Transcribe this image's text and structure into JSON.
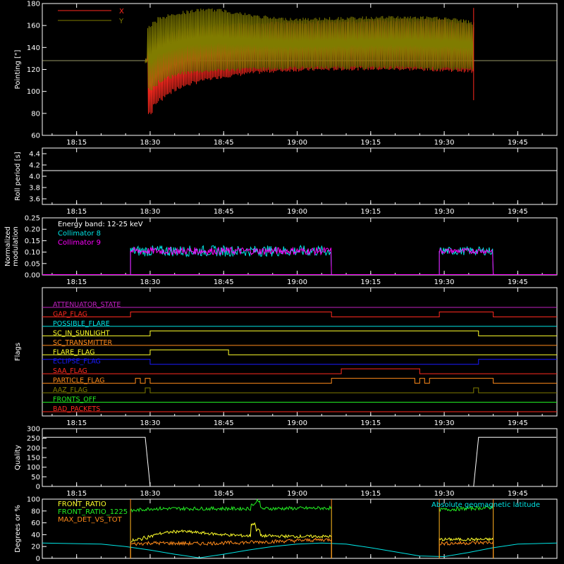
{
  "colors": {
    "background": "#000000",
    "axes": "#ffffff",
    "red": "#ff2a1f",
    "olive": "#807c00",
    "cyan": "#00e5e5",
    "magenta": "#ff00ff",
    "white": "#ffffff",
    "yellow": "#ffff2a",
    "orange": "#ff8a1a",
    "green": "#22ee22",
    "blue": "#1a1aff",
    "purple": "#c020c0"
  },
  "x_ticks": [
    "18:15",
    "18:30",
    "18:45",
    "19:00",
    "19:15",
    "19:30",
    "19:45"
  ],
  "chart_data": [
    {
      "type": "line",
      "name": "pointing",
      "ylabel": "Pointing [\"]",
      "ylim": [
        60,
        180
      ],
      "yticks": [
        "60",
        "80",
        "100",
        "120",
        "140",
        "160",
        "180"
      ],
      "legend": [
        {
          "label": "X",
          "color": "#ff2a1f"
        },
        {
          "label": "Y",
          "color": "#807c00"
        }
      ],
      "legend_position": "top-left",
      "reference_y": 128,
      "series": [
        {
          "name": "X",
          "color": "#ff2a1f",
          "x": [
            "18:29",
            "18:30",
            "18:31",
            "18:33",
            "18:36",
            "18:40",
            "18:45",
            "18:50",
            "18:55",
            "19:00",
            "19:10",
            "19:20",
            "19:30",
            "19:35",
            "19:36"
          ],
          "upper": [
            128,
            140,
            146,
            152,
            157,
            160,
            162,
            163,
            164,
            164,
            165,
            166,
            166,
            163,
            161
          ],
          "lower": [
            128,
            78,
            88,
            94,
            102,
            108,
            112,
            115,
            117,
            118,
            119,
            119,
            118,
            117,
            116
          ]
        },
        {
          "name": "Y",
          "color": "#807c00",
          "x": [
            "18:29",
            "18:30",
            "18:32",
            "18:35",
            "18:38",
            "18:41",
            "18:45",
            "18:50",
            "18:55",
            "19:00",
            "19:10",
            "19:20",
            "19:30",
            "19:35",
            "19:36"
          ],
          "upper": [
            128,
            160,
            168,
            172,
            174,
            176,
            175,
            171,
            168,
            167,
            168,
            169,
            168,
            165,
            163
          ],
          "lower": [
            128,
            100,
            108,
            113,
            116,
            117,
            118,
            119,
            119,
            120,
            120,
            120,
            119,
            119,
            118
          ]
        }
      ]
    },
    {
      "type": "line",
      "name": "roll-period",
      "ylabel": "Roll period [s]",
      "ylim": [
        3.5,
        4.5
      ],
      "yticks": [
        "3.6",
        "3.8",
        "4.0",
        "4.2",
        "4.4"
      ],
      "series": [
        {
          "name": "roll period",
          "color": "#ffffff",
          "x": [
            "18:15",
            "19:50"
          ],
          "y": [
            4.1,
            4.1
          ]
        }
      ]
    },
    {
      "type": "line",
      "name": "modulation",
      "ylabel": "Normalized modulation",
      "ylim": [
        0,
        0.25
      ],
      "yticks": [
        "0.00",
        "0.05",
        "0.10",
        "0.15",
        "0.20",
        "0.25"
      ],
      "annotation": "Energy band: 12-25 keV",
      "legend": [
        {
          "label": "Collimator 8",
          "color": "#00e5e5"
        },
        {
          "label": "Collimator 9",
          "color": "#ff00ff"
        }
      ],
      "segments": [
        {
          "start": "18:26",
          "end": "19:07",
          "mean": 0.105,
          "spread": 0.02
        },
        {
          "start": "19:29",
          "end": "19:40",
          "mean": 0.105,
          "spread": 0.015
        }
      ]
    },
    {
      "type": "step",
      "name": "flags",
      "ylabel": "Flags",
      "flags": [
        {
          "label": "ATTENUATOR_STATE",
          "color": "#c020c0",
          "steps": []
        },
        {
          "label": "GAP_FLAG",
          "color": "#ff2a1f",
          "steps": [
            [
              "18:15",
              0
            ],
            [
              "18:26",
              1
            ],
            [
              "19:07",
              0
            ],
            [
              "19:29",
              1
            ],
            [
              "19:40",
              0
            ]
          ]
        },
        {
          "label": "POSSIBLE_FLARE",
          "color": "#00e5e5",
          "steps": []
        },
        {
          "label": "SC_IN_SUNLIGHT",
          "color": "#ffff2a",
          "steps": [
            [
              "18:15",
              0
            ],
            [
              "18:30",
              1
            ],
            [
              "19:37",
              0
            ]
          ]
        },
        {
          "label": "SC_TRANSMITTER",
          "color": "#ff8a1a",
          "steps": []
        },
        {
          "label": "FLARE_FLAG",
          "color": "#ffff2a",
          "steps": [
            [
              "18:15",
              0
            ],
            [
              "18:30",
              1
            ],
            [
              "18:46",
              0
            ]
          ]
        },
        {
          "label": "ECLIPSE_FLAG",
          "color": "#1a1aff",
          "steps": [
            [
              "18:15",
              1
            ],
            [
              "18:30",
              0
            ],
            [
              "19:37",
              1
            ]
          ]
        },
        {
          "label": "SAA_FLAG",
          "color": "#ff2a1f",
          "steps": [
            [
              "18:15",
              0
            ],
            [
              "19:09",
              1
            ],
            [
              "19:25",
              0
            ]
          ]
        },
        {
          "label": "PARTICLE_FLAG",
          "color": "#ff8a1a",
          "steps": [
            [
              "18:15",
              0
            ],
            [
              "18:27",
              1
            ],
            [
              "18:28",
              0
            ],
            [
              "18:29",
              1
            ],
            [
              "18:30",
              0
            ],
            [
              "19:07",
              1
            ],
            [
              "19:24",
              0
            ],
            [
              "19:25",
              1
            ],
            [
              "19:26",
              0
            ],
            [
              "19:27",
              1
            ],
            [
              "19:40",
              0
            ]
          ]
        },
        {
          "label": "AAZ_FLAG",
          "color": "#807c00",
          "steps": [
            [
              "18:15",
              0
            ],
            [
              "18:29",
              1
            ],
            [
              "18:30",
              0
            ],
            [
              "19:36",
              1
            ],
            [
              "19:37",
              0
            ]
          ]
        },
        {
          "label": "FRONTS_OFF",
          "color": "#22ee22",
          "steps": []
        },
        {
          "label": "BAD_PACKETS",
          "color": "#ff2a1f",
          "steps": []
        }
      ]
    },
    {
      "type": "line",
      "name": "quality",
      "ylabel": "Quality",
      "ylim": [
        0,
        300
      ],
      "yticks": [
        "0",
        "50",
        "100",
        "150",
        "200",
        "250",
        "300"
      ],
      "series": [
        {
          "name": "quality",
          "color": "#ffffff",
          "x": [
            "18:15",
            "18:29",
            "18:30",
            "19:36",
            "19:37",
            "19:50"
          ],
          "y": [
            255,
            255,
            0,
            0,
            255,
            255
          ]
        }
      ]
    },
    {
      "type": "line",
      "name": "front-ratio",
      "ylabel": "Degrees or %",
      "ylim": [
        0,
        100
      ],
      "yticks": [
        "0",
        "20",
        "40",
        "60",
        "80",
        "100"
      ],
      "legend": [
        {
          "label": "FRONT_RATIO",
          "color": "#ffff2a"
        },
        {
          "label": "FRONT_RATIO_1225",
          "color": "#22ee22"
        },
        {
          "label": "MAX_DET_VS_TOT",
          "color": "#ff8a1a"
        }
      ],
      "annotation": "Absolute geomagnetic latitude",
      "annotation_color": "#00e5e5",
      "segments": [
        {
          "start": "18:26",
          "end": "19:07"
        },
        {
          "start": "19:29",
          "end": "19:40"
        }
      ],
      "series": [
        {
          "name": "FRONT_RATIO_1225",
          "color": "#22ee22",
          "x": [
            "18:26",
            "18:30",
            "18:50",
            "18:52",
            "18:53",
            "19:07",
            "19:29",
            "19:40"
          ],
          "y": [
            80,
            84,
            84,
            98,
            84,
            85,
            82,
            86
          ]
        },
        {
          "name": "FRONT_RATIO",
          "color": "#ffff2a",
          "x": [
            "18:26",
            "18:29",
            "18:32",
            "18:36",
            "18:45",
            "18:50",
            "18:51",
            "18:53",
            "19:00",
            "19:07",
            "19:29",
            "19:40"
          ],
          "y": [
            28,
            35,
            42,
            46,
            40,
            38,
            58,
            38,
            37,
            37,
            32,
            32
          ]
        },
        {
          "name": "MAX_DET_VS_TOT",
          "color": "#ff8a1a",
          "x": [
            "18:26",
            "18:30",
            "18:40",
            "18:50",
            "19:00",
            "19:07",
            "19:29",
            "19:40"
          ],
          "y": [
            24,
            26,
            25,
            27,
            30,
            32,
            25,
            27
          ]
        },
        {
          "name": "Absolute geomagnetic latitude",
          "color": "#00e5e5",
          "x": [
            "18:15",
            "18:20",
            "18:25",
            "18:30",
            "18:35",
            "18:40",
            "18:45",
            "18:50",
            "18:55",
            "19:00",
            "19:05",
            "19:10",
            "19:15",
            "19:20",
            "19:25",
            "19:30",
            "19:35",
            "19:40",
            "19:45",
            "19:50"
          ],
          "y": [
            26,
            24,
            20,
            14,
            7,
            1,
            7,
            14,
            20,
            24,
            26,
            24,
            18,
            11,
            4,
            3,
            10,
            18,
            24,
            26
          ]
        }
      ]
    }
  ]
}
